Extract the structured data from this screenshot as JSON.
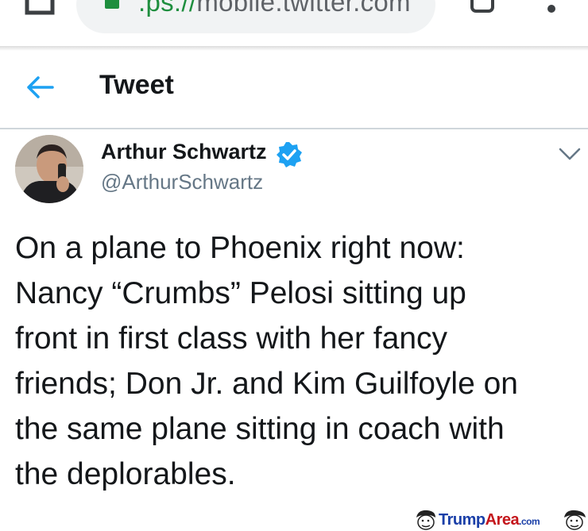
{
  "browser": {
    "url_scheme_fragment": ".ps://",
    "url_host": "mobile.twitter.com",
    "tab_count": "0",
    "icons": {
      "home": "home-icon",
      "lock": "lock-icon",
      "tabs": "tabs-icon",
      "menu": "more-vert-icon"
    }
  },
  "header": {
    "title": "Tweet",
    "back_icon": "arrow-left-icon"
  },
  "tweet": {
    "author_name": "Arthur Schwartz",
    "author_handle": "@ArthurSchwartz",
    "verified": true,
    "text": "On a plane to Phoenix right now:\nNancy “Crumbs” Pelosi sitting up\nfront in first class with her fancy\nfriends; Don Jr. and Kim Guilfoyle on\nthe same plane sitting in coach with\nthe deplorables."
  },
  "watermark": {
    "brand_part1": "Trump",
    "brand_part2": "Area",
    "suffix": ".com"
  },
  "colors": {
    "twitter_blue": "#1da1f2",
    "text_primary": "#14171a",
    "text_secondary": "#657786",
    "lock_green": "#1e8e3e"
  }
}
